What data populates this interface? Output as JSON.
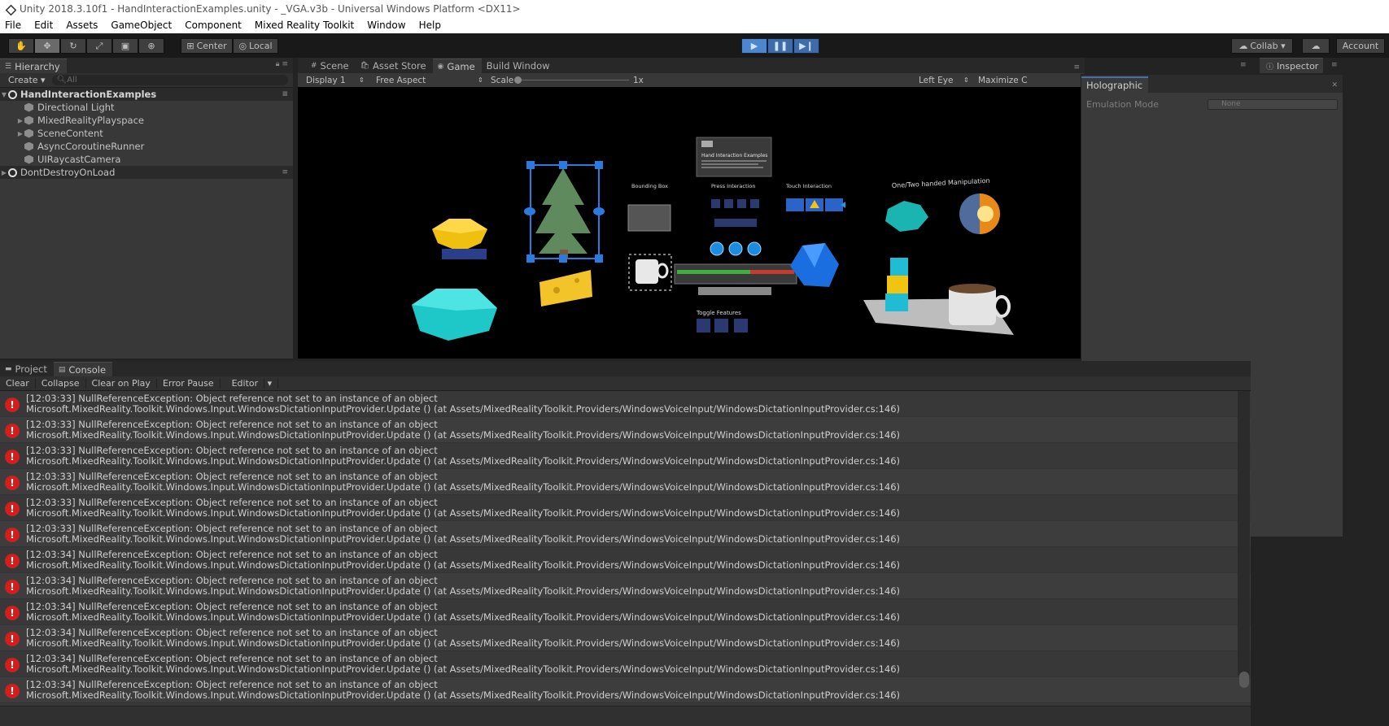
{
  "window": {
    "title": "Unity 2018.3.10f1 - HandInteractionExamples.unity - _VGA.v3b - Universal Windows Platform <DX11>"
  },
  "menu": [
    "File",
    "Edit",
    "Assets",
    "GameObject",
    "Component",
    "Mixed Reality Toolkit",
    "Window",
    "Help"
  ],
  "toolbar": {
    "pivot": "Center",
    "space": "Local",
    "collab": "Collab",
    "account": "Account",
    "colors": {
      "play": "#4b86cf"
    }
  },
  "hierarchy": {
    "tab": "Hierarchy",
    "create": "Create",
    "search_placeholder": "All",
    "scene": "HandInteractionExamples",
    "items": [
      "Directional Light",
      "MixedRealityPlayspace",
      "SceneContent",
      "AsyncCoroutineRunner",
      "UIRaycastCamera"
    ],
    "dont_destroy": "DontDestroyOnLoad"
  },
  "game": {
    "tabs": [
      "Scene",
      "Asset Store",
      "Game",
      "Build Window"
    ],
    "display": "Display 1",
    "aspect": "Free Aspect",
    "scale_label": "Scale",
    "scale_value": "1x",
    "eye": "Left Eye",
    "maximize": "Maximize C",
    "scene_labels": {
      "bounding_box": "Bounding Box",
      "press_interaction": "Press Interaction",
      "touch_interaction": "Touch Interaction",
      "manipulation": "One/Two handed Manipulation",
      "toggle_features": "Toggle Features",
      "panel_title": "Hand Interaction Examples"
    }
  },
  "inspector": {
    "tab": "Inspector",
    "holographic_tab": "Holographic",
    "emulation_label": "Emulation Mode",
    "emulation_value": "None"
  },
  "console": {
    "tabs": [
      "Project",
      "Console"
    ],
    "buttons": [
      "Clear",
      "Collapse",
      "Clear on Play",
      "Error Pause",
      "Editor"
    ],
    "entries": [
      {
        "line1": "[12:03:33] NullReferenceException: Object reference not set to an instance of an object",
        "line2": "Microsoft.MixedReality.Toolkit.Windows.Input.WindowsDictationInputProvider.Update () (at Assets/MixedRealityToolkit.Providers/WindowsVoiceInput/WindowsDictationInputProvider.cs:146)"
      },
      {
        "line1": "[12:03:33] NullReferenceException: Object reference not set to an instance of an object",
        "line2": "Microsoft.MixedReality.Toolkit.Windows.Input.WindowsDictationInputProvider.Update () (at Assets/MixedRealityToolkit.Providers/WindowsVoiceInput/WindowsDictationInputProvider.cs:146)"
      },
      {
        "line1": "[12:03:33] NullReferenceException: Object reference not set to an instance of an object",
        "line2": "Microsoft.MixedReality.Toolkit.Windows.Input.WindowsDictationInputProvider.Update () (at Assets/MixedRealityToolkit.Providers/WindowsVoiceInput/WindowsDictationInputProvider.cs:146)"
      },
      {
        "line1": "[12:03:33] NullReferenceException: Object reference not set to an instance of an object",
        "line2": "Microsoft.MixedReality.Toolkit.Windows.Input.WindowsDictationInputProvider.Update () (at Assets/MixedRealityToolkit.Providers/WindowsVoiceInput/WindowsDictationInputProvider.cs:146)"
      },
      {
        "line1": "[12:03:33] NullReferenceException: Object reference not set to an instance of an object",
        "line2": "Microsoft.MixedReality.Toolkit.Windows.Input.WindowsDictationInputProvider.Update () (at Assets/MixedRealityToolkit.Providers/WindowsVoiceInput/WindowsDictationInputProvider.cs:146)"
      },
      {
        "line1": "[12:03:33] NullReferenceException: Object reference not set to an instance of an object",
        "line2": "Microsoft.MixedReality.Toolkit.Windows.Input.WindowsDictationInputProvider.Update () (at Assets/MixedRealityToolkit.Providers/WindowsVoiceInput/WindowsDictationInputProvider.cs:146)"
      },
      {
        "line1": "[12:03:34] NullReferenceException: Object reference not set to an instance of an object",
        "line2": "Microsoft.MixedReality.Toolkit.Windows.Input.WindowsDictationInputProvider.Update () (at Assets/MixedRealityToolkit.Providers/WindowsVoiceInput/WindowsDictationInputProvider.cs:146)"
      },
      {
        "line1": "[12:03:34] NullReferenceException: Object reference not set to an instance of an object",
        "line2": "Microsoft.MixedReality.Toolkit.Windows.Input.WindowsDictationInputProvider.Update () (at Assets/MixedRealityToolkit.Providers/WindowsVoiceInput/WindowsDictationInputProvider.cs:146)"
      },
      {
        "line1": "[12:03:34] NullReferenceException: Object reference not set to an instance of an object",
        "line2": "Microsoft.MixedReality.Toolkit.Windows.Input.WindowsDictationInputProvider.Update () (at Assets/MixedRealityToolkit.Providers/WindowsVoiceInput/WindowsDictationInputProvider.cs:146)"
      },
      {
        "line1": "[12:03:34] NullReferenceException: Object reference not set to an instance of an object",
        "line2": "Microsoft.MixedReality.Toolkit.Windows.Input.WindowsDictationInputProvider.Update () (at Assets/MixedRealityToolkit.Providers/WindowsVoiceInput/WindowsDictationInputProvider.cs:146)"
      },
      {
        "line1": "[12:03:34] NullReferenceException: Object reference not set to an instance of an object",
        "line2": "Microsoft.MixedReality.Toolkit.Windows.Input.WindowsDictationInputProvider.Update () (at Assets/MixedRealityToolkit.Providers/WindowsVoiceInput/WindowsDictationInputProvider.cs:146)"
      },
      {
        "line1": "[12:03:34] NullReferenceException: Object reference not set to an instance of an object",
        "line2": "Microsoft.MixedReality.Toolkit.Windows.Input.WindowsDictationInputProvider.Update () (at Assets/MixedRealityToolkit.Providers/WindowsVoiceInput/WindowsDictationInputProvider.cs:146)"
      }
    ]
  }
}
